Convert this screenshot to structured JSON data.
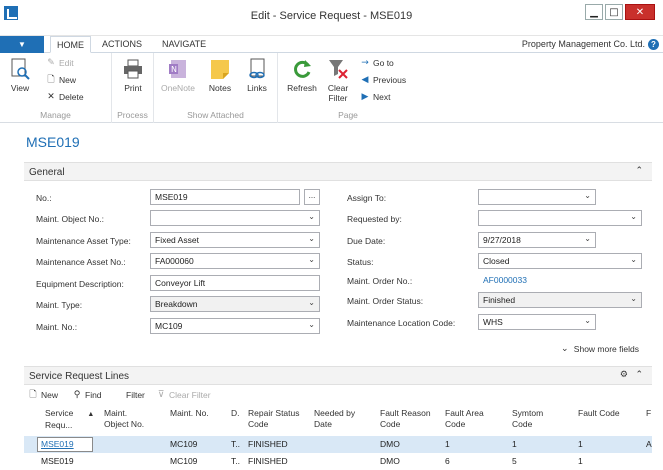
{
  "window": {
    "title": "Edit - Service Request - MSE019",
    "minimize": "▁",
    "maximize": "□",
    "close": "✕"
  },
  "ribbon_tabs": {
    "file": "▼",
    "home": "HOME",
    "actions": "ACTIONS",
    "navigate": "NAVIGATE",
    "company": "Property Management Co. Ltd.",
    "help": "?"
  },
  "ribbon": {
    "manage": {
      "label": "Manage",
      "view": "View",
      "edit": "Edit",
      "new": "New",
      "delete": "Delete"
    },
    "process": {
      "label": "Process",
      "print": "Print"
    },
    "show_attached": {
      "label": "Show Attached",
      "onenote": "OneNote",
      "notes": "Notes",
      "links": "Links"
    },
    "page": {
      "label": "Page",
      "refresh": "Refresh",
      "clear_filter_1": "Clear",
      "clear_filter_2": "Filter",
      "go_to": "Go to",
      "previous": "Previous",
      "next": "Next"
    }
  },
  "record_title": "MSE019",
  "general": {
    "title": "General",
    "fields": {
      "no_label": "No.:",
      "no_value": "MSE019",
      "maint_object_label": "Maint. Object No.:",
      "maint_object_value": "",
      "asset_type_label": "Maintenance Asset Type:",
      "asset_type_value": "Fixed Asset",
      "asset_no_label": "Maintenance Asset No.:",
      "asset_no_value": "FA000060",
      "equipment_label": "Equipment Description:",
      "equipment_value": "Conveyor Lift",
      "maint_type_label": "Maint. Type:",
      "maint_type_value": "Breakdown",
      "maint_no_label": "Maint. No.:",
      "maint_no_value": "MC109",
      "assign_to_label": "Assign To:",
      "assign_to_value": "",
      "requested_by_label": "Requested by:",
      "requested_by_value": "",
      "due_date_label": "Due Date:",
      "due_date_value": "9/27/2018",
      "status_label": "Status:",
      "status_value": "Closed",
      "order_no_label": "Maint. Order No.:",
      "order_no_value": "AF0000033",
      "order_status_label": "Maint. Order Status:",
      "order_status_value": "Finished",
      "location_label": "Maintenance Location Code:",
      "location_value": "WHS"
    },
    "assist": "...",
    "show_more": "Show more fields"
  },
  "lines": {
    "title": "Service Request Lines",
    "toolbar": {
      "new": "New",
      "find": "Find",
      "filter": "Filter",
      "clear_filter": "Clear Filter"
    },
    "columns": {
      "c1a": "Service",
      "c1b": "Requ...",
      "c2a": "Maint.",
      "c2b": "Object No.",
      "c3": "Maint. No.",
      "c4": "D.",
      "c5a": "Repair Status",
      "c5b": "Code",
      "c6a": "Needed by",
      "c6b": "Date",
      "c7a": "Fault Reason",
      "c7b": "Code",
      "c8a": "Fault Area",
      "c8b": "Code",
      "c9a": "Symtom",
      "c9b": "Code",
      "c10": "Fault Code",
      "c11": "F"
    },
    "rows": [
      {
        "req": "MSE019",
        "obj": "",
        "maint": "MC109",
        "d": "T..",
        "repair": "FINISHED",
        "needed": "",
        "reason": "DMO",
        "area": "1",
        "symptom": "1",
        "fault": "1",
        "extra": "A"
      },
      {
        "req": "MSE019",
        "obj": "",
        "maint": "MC109",
        "d": "T..",
        "repair": "FINISHED",
        "needed": "",
        "reason": "DMO",
        "area": "6",
        "symptom": "5",
        "fault": "1",
        "extra": ""
      }
    ]
  },
  "colors": {
    "accent": "#1f6fb5",
    "selected_row": "#d9e8f6"
  }
}
